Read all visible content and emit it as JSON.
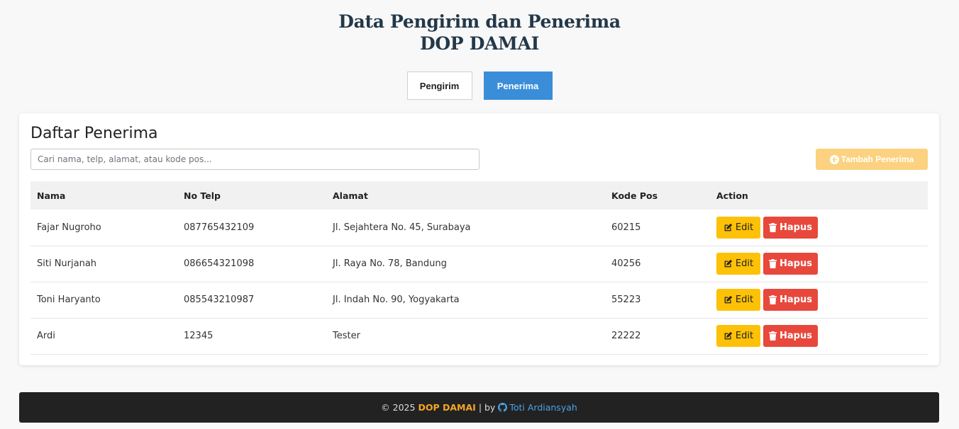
{
  "header": {
    "title_line1": "Data Pengirim dan Penerima",
    "title_line2": "DOP DAMAI"
  },
  "tabs": [
    {
      "label": "Pengirim",
      "active": false
    },
    {
      "label": "Penerima",
      "active": true
    }
  ],
  "card": {
    "title": "Daftar Penerima",
    "search_placeholder": "Cari nama, telp, alamat, atau kode pos...",
    "add_label": "Tambah Penerima"
  },
  "table": {
    "headers": {
      "nama": "Nama",
      "telp": "No Telp",
      "alamat": "Alamat",
      "kode": "Kode Pos",
      "action": "Action"
    },
    "rows": [
      {
        "nama": "Fajar Nugroho",
        "telp": "087765432109",
        "alamat": "Jl. Sejahtera No. 45, Surabaya",
        "kode": "60215"
      },
      {
        "nama": "Siti Nurjanah",
        "telp": "086654321098",
        "alamat": "Jl. Raya No. 78, Bandung",
        "kode": "40256"
      },
      {
        "nama": "Toni Haryanto",
        "telp": "085543210987",
        "alamat": "Jl. Indah No. 90, Yogyakarta",
        "kode": "55223"
      },
      {
        "nama": "Ardi",
        "telp": "12345",
        "alamat": "Tester",
        "kode": "22222"
      }
    ],
    "edit_label": "Edit",
    "hapus_label": "Hapus"
  },
  "footer": {
    "copyright": "© 2025",
    "brand": "DOP DAMAI",
    "separator": "| by",
    "author": "Toti Ardiansyah"
  },
  "colors": {
    "accent_blue": "#3a8ed9",
    "edit_yellow": "#fdc107",
    "hapus_red": "#e8483c",
    "footer_bg": "#222222",
    "brand_orange": "#f5a623"
  },
  "icons": {
    "add": "plus-circle-icon",
    "edit": "edit-icon",
    "hapus": "trash-icon",
    "author": "github-icon"
  }
}
